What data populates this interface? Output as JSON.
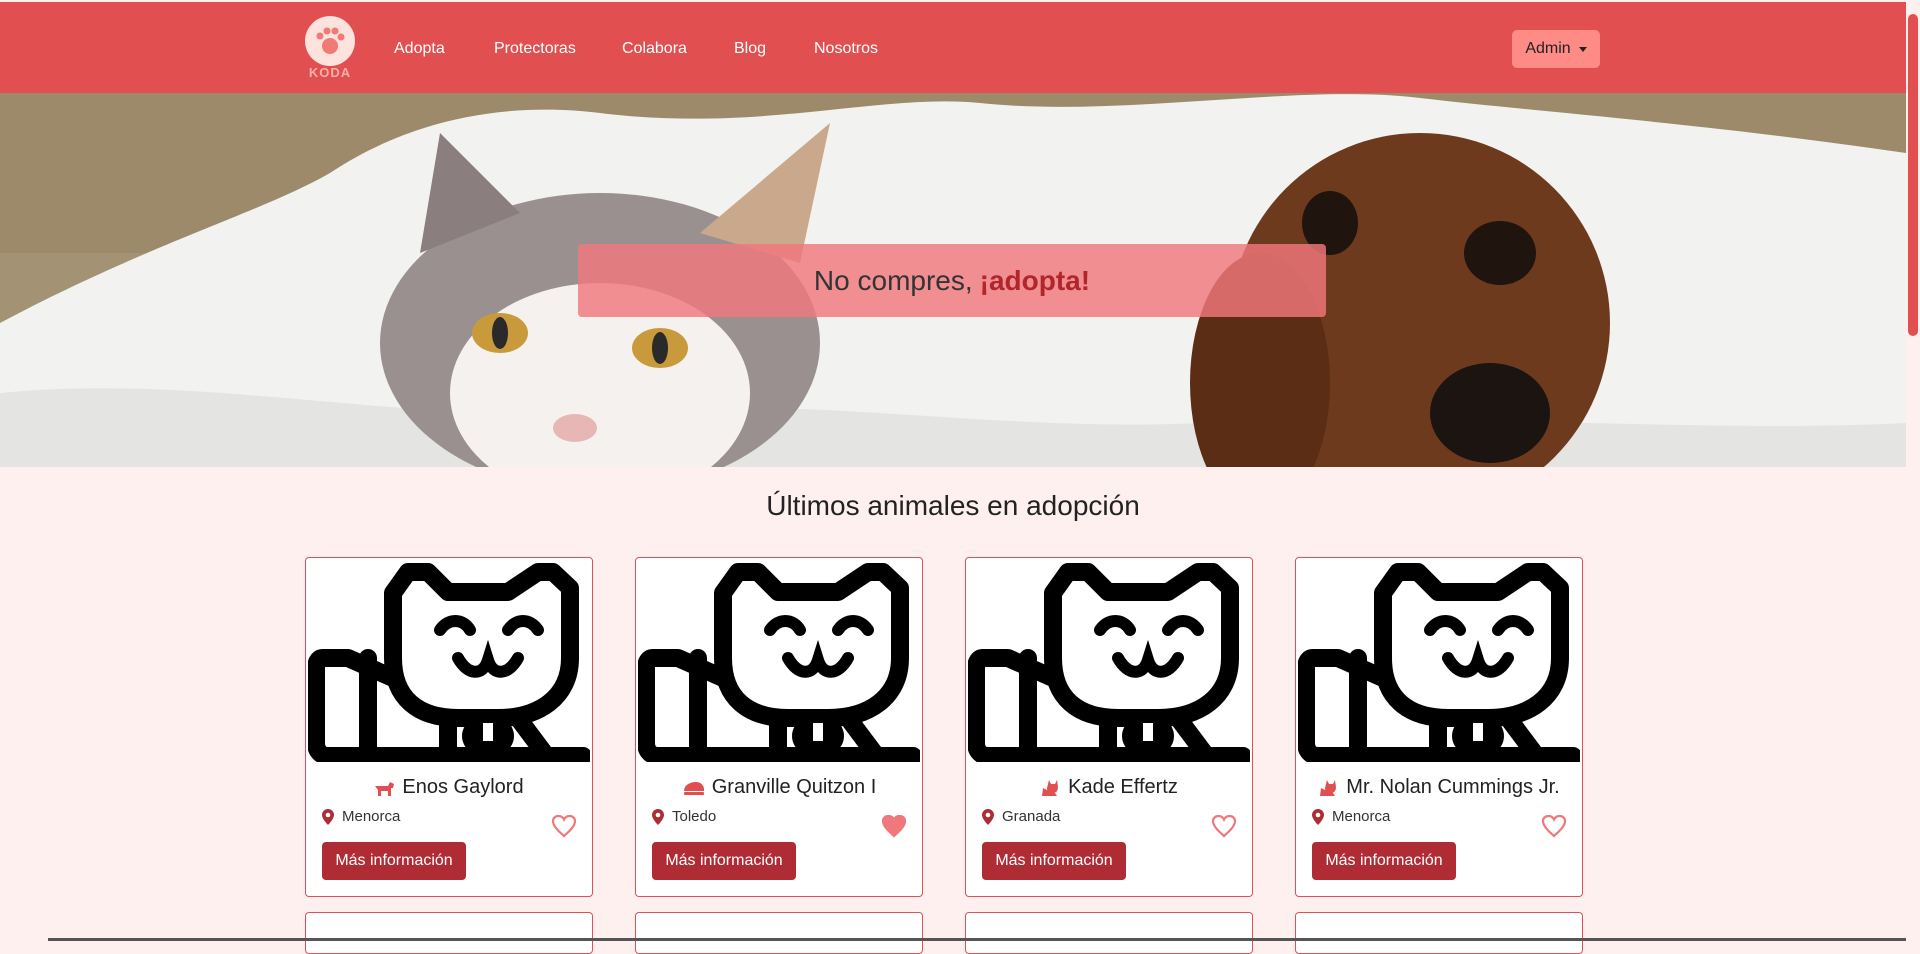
{
  "brand": {
    "logo_text": "KODA",
    "color": "#e14f50"
  },
  "nav": {
    "links": [
      "Adopta",
      "Protectoras",
      "Colabora",
      "Blog",
      "Nosotros"
    ],
    "admin_label": "Admin"
  },
  "hero": {
    "text_plain": "No compres,",
    "text_accent": "¡adopta!"
  },
  "section_title": "Últimos animales en adopción",
  "cards": [
    {
      "name": "Enos Gaylord",
      "species_icon": "dog-icon",
      "location": "Menorca",
      "favorite": false,
      "button": "Más información"
    },
    {
      "name": "Granville Quitzon I",
      "species_icon": "rodent-icon",
      "location": "Toledo",
      "favorite": true,
      "button": "Más información"
    },
    {
      "name": "Kade Effertz",
      "species_icon": "cat-icon",
      "location": "Granada",
      "favorite": false,
      "button": "Más información"
    },
    {
      "name": "Mr. Nolan Cummings Jr.",
      "species_icon": "cat-icon",
      "location": "Menorca",
      "favorite": false,
      "button": "Más información"
    }
  ],
  "colors": {
    "accent": "#e14f50",
    "button": "#b02c35",
    "background": "#fff0f0"
  }
}
